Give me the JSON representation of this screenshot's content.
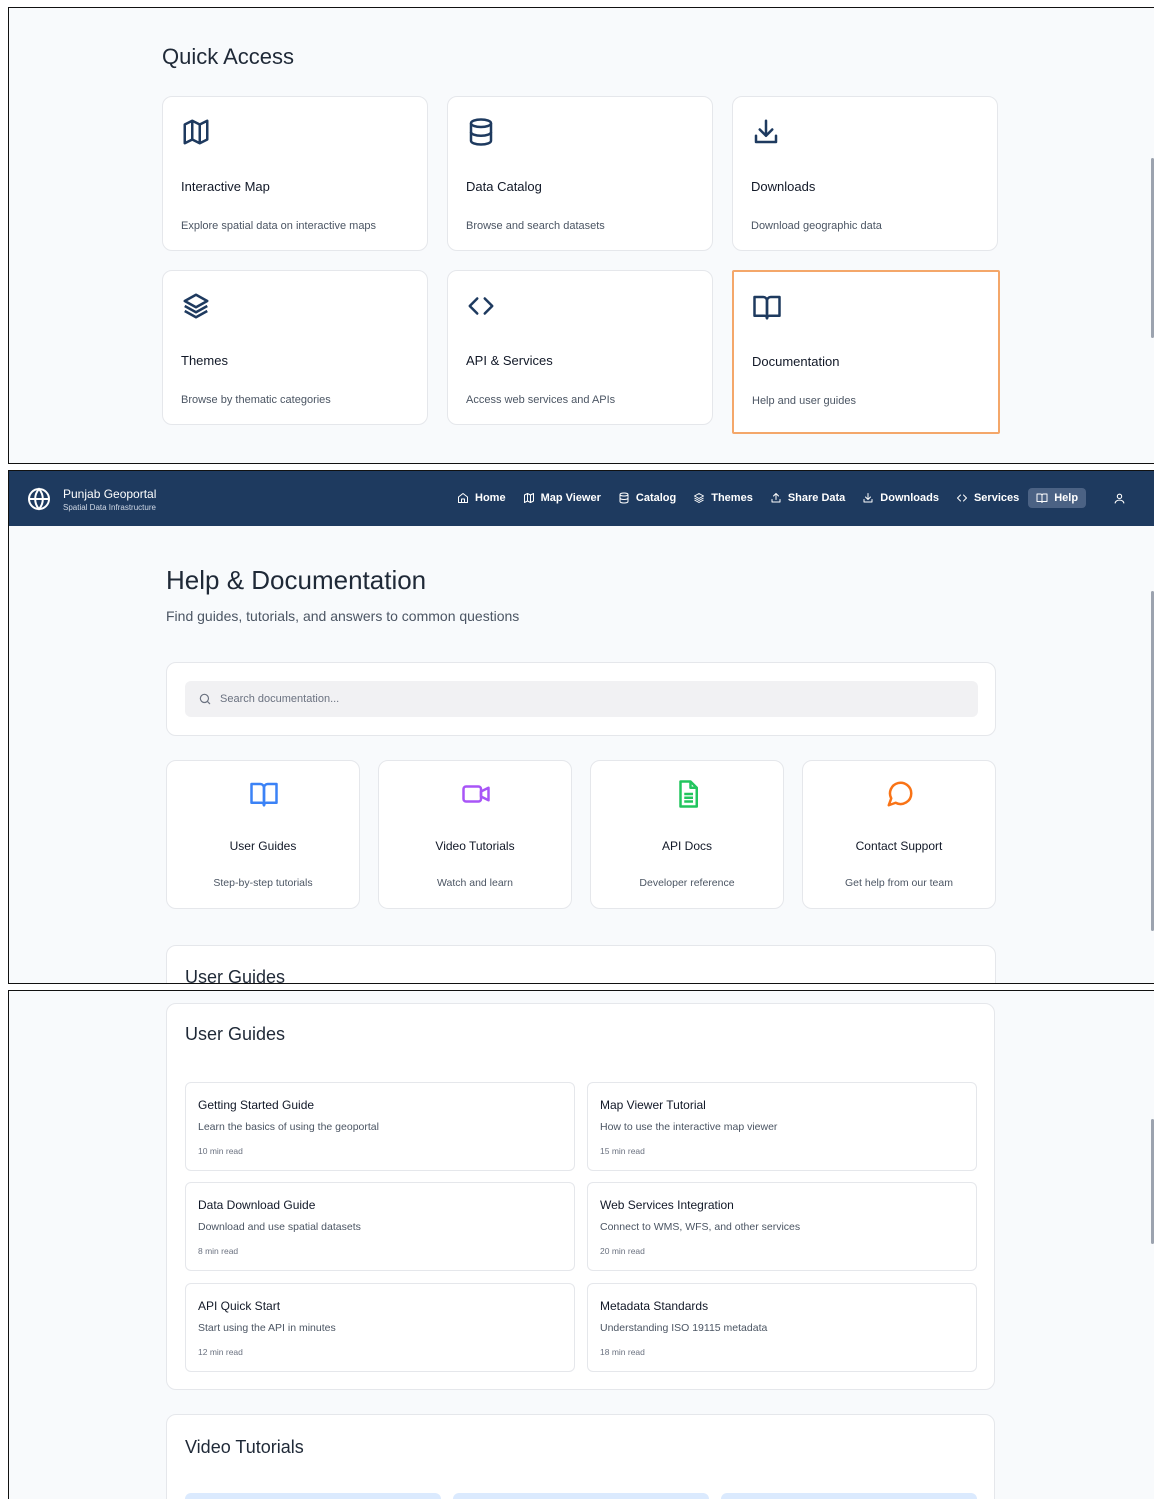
{
  "quick_access": {
    "title": "Quick Access",
    "cards": [
      {
        "name": "Interactive Map",
        "desc": "Explore spatial data on interactive maps",
        "icon": "map-icon"
      },
      {
        "name": "Data Catalog",
        "desc": "Browse and search datasets",
        "icon": "database-icon"
      },
      {
        "name": "Downloads",
        "desc": "Download geographic data",
        "icon": "download-icon"
      },
      {
        "name": "Themes",
        "desc": "Browse by thematic categories",
        "icon": "layers-icon"
      },
      {
        "name": "API & Services",
        "desc": "Access web services and APIs",
        "icon": "code-icon"
      },
      {
        "name": "Documentation",
        "desc": "Help and user guides",
        "icon": "book-open-icon"
      }
    ],
    "highlight_color": "#f4a76a"
  },
  "nav": {
    "brand": "Punjab Geoportal",
    "subtitle": "Spatial Data Infrastructure",
    "items": [
      {
        "label": "Home",
        "icon": "home-icon"
      },
      {
        "label": "Map Viewer",
        "icon": "map-icon"
      },
      {
        "label": "Catalog",
        "icon": "database-icon"
      },
      {
        "label": "Themes",
        "icon": "layers-icon"
      },
      {
        "label": "Share Data",
        "icon": "upload-icon"
      },
      {
        "label": "Downloads",
        "icon": "download-icon"
      },
      {
        "label": "Services",
        "icon": "code-icon"
      },
      {
        "label": "Help",
        "icon": "book-open-icon",
        "active": true
      }
    ],
    "bg_color": "#1e3a5f"
  },
  "help": {
    "title": "Help & Documentation",
    "subtitle": "Find guides, tutorials, and answers to common questions",
    "search_placeholder": "Search documentation...",
    "categories": [
      {
        "name": "User Guides",
        "desc": "Step-by-step tutorials",
        "icon": "book-open-icon",
        "color": "#3b82f6"
      },
      {
        "name": "Video Tutorials",
        "desc": "Watch and learn",
        "icon": "video-icon",
        "color": "#a855f7"
      },
      {
        "name": "API Docs",
        "desc": "Developer reference",
        "icon": "file-text-icon",
        "color": "#22c55e"
      },
      {
        "name": "Contact Support",
        "desc": "Get help from our team",
        "icon": "message-circle-icon",
        "color": "#f97316"
      }
    ]
  },
  "user_guides": {
    "title": "User Guides",
    "guides": [
      {
        "title": "Getting Started Guide",
        "desc": "Learn the basics of using the geoportal",
        "time": "10 min read"
      },
      {
        "title": "Map Viewer Tutorial",
        "desc": "How to use the interactive map viewer",
        "time": "15 min read"
      },
      {
        "title": "Data Download Guide",
        "desc": "Download and use spatial datasets",
        "time": "8 min read"
      },
      {
        "title": "Web Services Integration",
        "desc": "Connect to WMS, WFS, and other services",
        "time": "20 min read"
      },
      {
        "title": "API Quick Start",
        "desc": "Start using the API in minutes",
        "time": "12 min read"
      },
      {
        "title": "Metadata Standards",
        "desc": "Understanding ISO 19115 metadata",
        "time": "18 min read"
      }
    ]
  },
  "video_tutorials": {
    "title": "Video Tutorials"
  }
}
